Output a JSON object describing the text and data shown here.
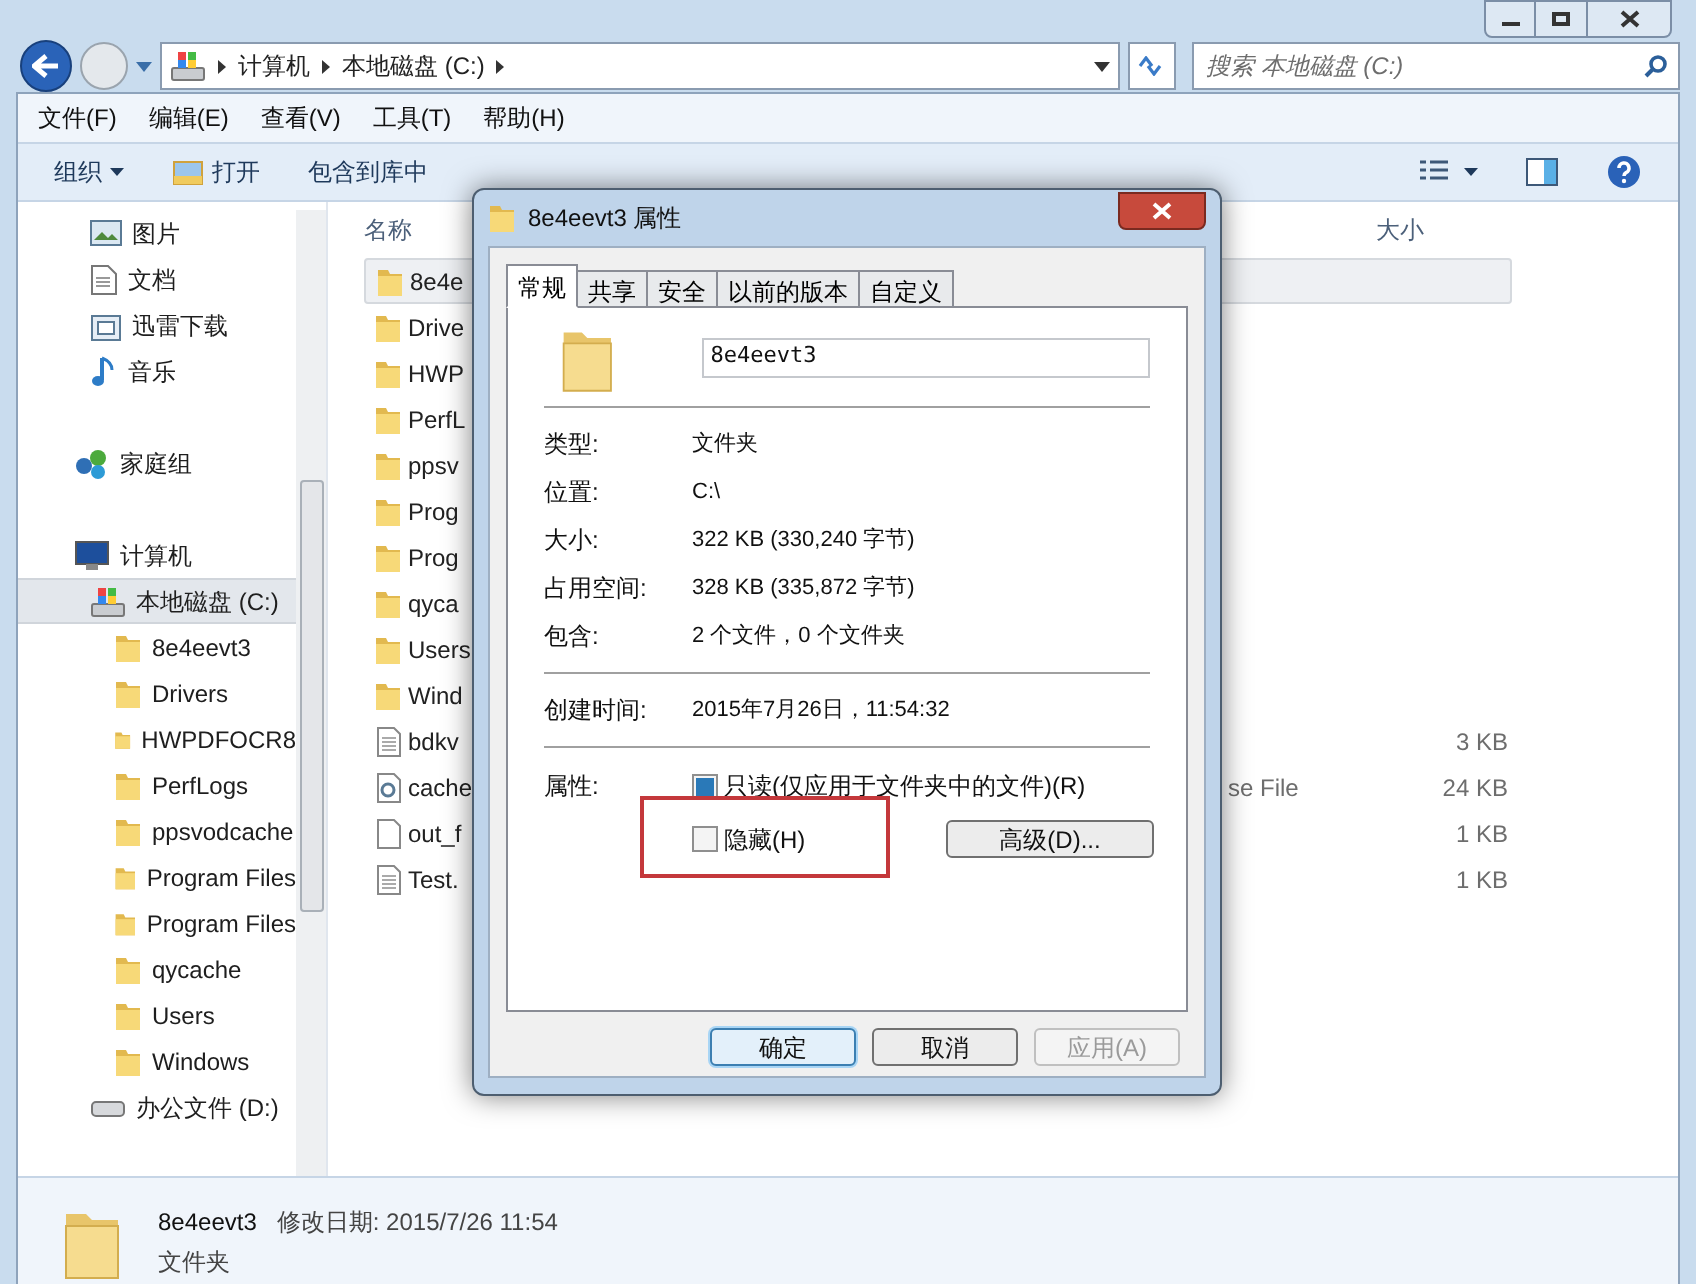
{
  "address_bar": {
    "path": [
      "计算机",
      "本地磁盘 (C:)"
    ]
  },
  "search": {
    "placeholder": "搜索 本地磁盘 (C:)"
  },
  "menu": [
    "文件(F)",
    "编辑(E)",
    "查看(V)",
    "工具(T)",
    "帮助(H)"
  ],
  "toolbar": [
    {
      "label": "组织",
      "kind": "dropdown"
    },
    {
      "label": "打开",
      "kind": "open"
    },
    {
      "label": "包含到库中",
      "kind": "plain"
    }
  ],
  "sidebar": {
    "groups": [
      {
        "items": [
          {
            "label": "图片",
            "kind": "pictures",
            "selected": false
          },
          {
            "label": "文档",
            "kind": "documents",
            "selected": false
          },
          {
            "label": "迅雷下载",
            "kind": "download",
            "selected": false
          },
          {
            "label": "音乐",
            "kind": "music",
            "selected": false
          }
        ]
      },
      {
        "items": [
          {
            "label": "家庭组",
            "kind": "homegroup",
            "selected": false
          }
        ]
      },
      {
        "items": [
          {
            "label": "计算机",
            "kind": "computer",
            "selected": false,
            "children": [
              {
                "label": "本地磁盘 (C:)",
                "kind": "drive",
                "selected": true,
                "children": [
                  {
                    "label": "8e4eevt3",
                    "kind": "folder",
                    "selected": false
                  },
                  {
                    "label": "Drivers",
                    "kind": "folder",
                    "selected": false
                  },
                  {
                    "label": "HWPDFOCR8",
                    "kind": "folder",
                    "selected": false
                  },
                  {
                    "label": "PerfLogs",
                    "kind": "folder",
                    "selected": false
                  },
                  {
                    "label": "ppsvodcache",
                    "kind": "folder",
                    "selected": false
                  },
                  {
                    "label": "Program Files",
                    "kind": "folder",
                    "selected": false
                  },
                  {
                    "label": "Program Files",
                    "kind": "folder",
                    "selected": false
                  },
                  {
                    "label": "qycache",
                    "kind": "folder",
                    "selected": false
                  },
                  {
                    "label": "Users",
                    "kind": "folder",
                    "selected": false
                  },
                  {
                    "label": "Windows",
                    "kind": "folder",
                    "selected": false
                  }
                ]
              },
              {
                "label": "办公文件 (D:)",
                "kind": "disk",
                "selected": false
              }
            ]
          }
        ]
      }
    ]
  },
  "table": {
    "columns": [
      "名称",
      "大小"
    ],
    "rows": [
      {
        "name": "8e4e",
        "kind": "folder",
        "selected": true
      },
      {
        "name": "Drive",
        "kind": "folder",
        "selected": false
      },
      {
        "name": "HWP",
        "kind": "folder",
        "selected": false
      },
      {
        "name": "PerfL",
        "kind": "folder",
        "selected": false
      },
      {
        "name": "ppsv",
        "kind": "folder",
        "selected": false
      },
      {
        "name": "Prog",
        "kind": "folder",
        "selected": false
      },
      {
        "name": "Prog",
        "kind": "folder",
        "selected": false
      },
      {
        "name": "qyca",
        "kind": "folder",
        "selected": false
      },
      {
        "name": "Users",
        "kind": "folder",
        "selected": false
      },
      {
        "name": "Wind",
        "kind": "folder",
        "selected": false
      },
      {
        "name": "bdkv",
        "kind": "text",
        "selected": false,
        "size": "3 KB"
      },
      {
        "name": "cache",
        "kind": "config",
        "selected": false,
        "type": "se File",
        "size": "24 KB"
      },
      {
        "name": "out_f",
        "kind": "blank",
        "selected": false,
        "size": "1 KB"
      },
      {
        "name": "Test.",
        "kind": "text",
        "selected": false,
        "size": "1 KB"
      }
    ]
  },
  "details": {
    "name": "8e4eevt3",
    "modified": "修改日期: 2015/7/26 11:54",
    "type": "文件夹"
  },
  "dialog": {
    "title": "8e4eevt3 属性",
    "tabs": [
      {
        "label": "常规",
        "selected": true
      },
      {
        "label": "共享",
        "selected": false
      },
      {
        "label": "安全",
        "selected": false
      },
      {
        "label": "以前的版本",
        "selected": false
      },
      {
        "label": "自定义",
        "selected": false
      }
    ],
    "name": "8e4eevt3",
    "sections": [
      [
        {
          "label": "类型:",
          "value": "文件夹"
        },
        {
          "label": "位置:",
          "value": "C:\\"
        },
        {
          "label": "大小:",
          "value": "322 KB (330,240 字节)"
        },
        {
          "label": "占用空间:",
          "value": "328 KB (335,872 字节)"
        },
        {
          "label": "包含:",
          "value": "2 个文件，0 个文件夹"
        }
      ],
      [
        {
          "label": "创建时间:",
          "value": "2015年7月26日，11:54:32"
        }
      ]
    ],
    "attributes_label": "属性:",
    "attributes": [
      {
        "label": "只读(仅应用于文件夹中的文件)(R)",
        "checked": true,
        "highlighted": false
      },
      {
        "label": "隐藏(H)",
        "checked": false,
        "highlighted": true
      }
    ],
    "advanced_button": "高级(D)...",
    "buttons": [
      {
        "label": "确定",
        "default": true,
        "disabled": false
      },
      {
        "label": "取消",
        "default": false,
        "disabled": false
      },
      {
        "label": "应用(A)",
        "default": false,
        "disabled": true
      }
    ]
  }
}
